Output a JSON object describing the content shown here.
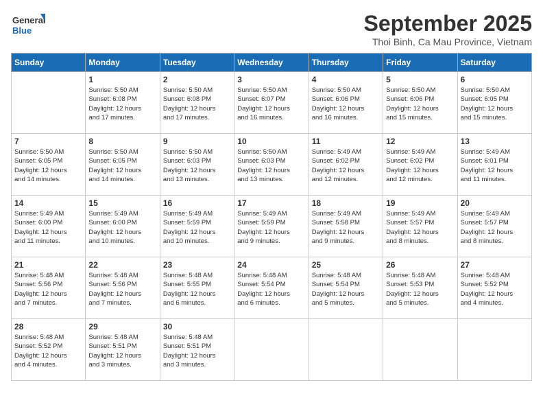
{
  "logo": {
    "line1": "General",
    "line2": "Blue"
  },
  "title": "September 2025",
  "location": "Thoi Binh, Ca Mau Province, Vietnam",
  "days_of_week": [
    "Sunday",
    "Monday",
    "Tuesday",
    "Wednesday",
    "Thursday",
    "Friday",
    "Saturday"
  ],
  "weeks": [
    [
      {
        "day": "",
        "info": ""
      },
      {
        "day": "1",
        "info": "Sunrise: 5:50 AM\nSunset: 6:08 PM\nDaylight: 12 hours\nand 17 minutes."
      },
      {
        "day": "2",
        "info": "Sunrise: 5:50 AM\nSunset: 6:08 PM\nDaylight: 12 hours\nand 17 minutes."
      },
      {
        "day": "3",
        "info": "Sunrise: 5:50 AM\nSunset: 6:07 PM\nDaylight: 12 hours\nand 16 minutes."
      },
      {
        "day": "4",
        "info": "Sunrise: 5:50 AM\nSunset: 6:06 PM\nDaylight: 12 hours\nand 16 minutes."
      },
      {
        "day": "5",
        "info": "Sunrise: 5:50 AM\nSunset: 6:06 PM\nDaylight: 12 hours\nand 15 minutes."
      },
      {
        "day": "6",
        "info": "Sunrise: 5:50 AM\nSunset: 6:05 PM\nDaylight: 12 hours\nand 15 minutes."
      }
    ],
    [
      {
        "day": "7",
        "info": ""
      },
      {
        "day": "8",
        "info": "Sunrise: 5:50 AM\nSunset: 6:05 PM\nDaylight: 12 hours\nand 14 minutes."
      },
      {
        "day": "9",
        "info": "Sunrise: 5:50 AM\nSunset: 6:03 PM\nDaylight: 12 hours\nand 13 minutes."
      },
      {
        "day": "10",
        "info": "Sunrise: 5:50 AM\nSunset: 6:03 PM\nDaylight: 12 hours\nand 13 minutes."
      },
      {
        "day": "11",
        "info": "Sunrise: 5:49 AM\nSunset: 6:02 PM\nDaylight: 12 hours\nand 12 minutes."
      },
      {
        "day": "12",
        "info": "Sunrise: 5:49 AM\nSunset: 6:02 PM\nDaylight: 12 hours\nand 12 minutes."
      },
      {
        "day": "13",
        "info": "Sunrise: 5:49 AM\nSunset: 6:01 PM\nDaylight: 12 hours\nand 11 minutes."
      }
    ],
    [
      {
        "day": "14",
        "info": ""
      },
      {
        "day": "15",
        "info": "Sunrise: 5:49 AM\nSunset: 6:00 PM\nDaylight: 12 hours\nand 10 minutes."
      },
      {
        "day": "16",
        "info": "Sunrise: 5:49 AM\nSunset: 5:59 PM\nDaylight: 12 hours\nand 10 minutes."
      },
      {
        "day": "17",
        "info": "Sunrise: 5:49 AM\nSunset: 5:59 PM\nDaylight: 12 hours\nand 9 minutes."
      },
      {
        "day": "18",
        "info": "Sunrise: 5:49 AM\nSunset: 5:58 PM\nDaylight: 12 hours\nand 9 minutes."
      },
      {
        "day": "19",
        "info": "Sunrise: 5:49 AM\nSunset: 5:57 PM\nDaylight: 12 hours\nand 8 minutes."
      },
      {
        "day": "20",
        "info": "Sunrise: 5:49 AM\nSunset: 5:57 PM\nDaylight: 12 hours\nand 8 minutes."
      }
    ],
    [
      {
        "day": "21",
        "info": ""
      },
      {
        "day": "22",
        "info": "Sunrise: 5:48 AM\nSunset: 5:56 PM\nDaylight: 12 hours\nand 7 minutes."
      },
      {
        "day": "23",
        "info": "Sunrise: 5:48 AM\nSunset: 5:55 PM\nDaylight: 12 hours\nand 6 minutes."
      },
      {
        "day": "24",
        "info": "Sunrise: 5:48 AM\nSunset: 5:54 PM\nDaylight: 12 hours\nand 6 minutes."
      },
      {
        "day": "25",
        "info": "Sunrise: 5:48 AM\nSunset: 5:54 PM\nDaylight: 12 hours\nand 5 minutes."
      },
      {
        "day": "26",
        "info": "Sunrise: 5:48 AM\nSunset: 5:53 PM\nDaylight: 12 hours\nand 5 minutes."
      },
      {
        "day": "27",
        "info": "Sunrise: 5:48 AM\nSunset: 5:52 PM\nDaylight: 12 hours\nand 4 minutes."
      }
    ],
    [
      {
        "day": "28",
        "info": "Sunrise: 5:48 AM\nSunset: 5:52 PM\nDaylight: 12 hours\nand 4 minutes."
      },
      {
        "day": "29",
        "info": "Sunrise: 5:48 AM\nSunset: 5:51 PM\nDaylight: 12 hours\nand 3 minutes."
      },
      {
        "day": "30",
        "info": "Sunrise: 5:48 AM\nSunset: 5:51 PM\nDaylight: 12 hours\nand 3 minutes."
      },
      {
        "day": "",
        "info": ""
      },
      {
        "day": "",
        "info": ""
      },
      {
        "day": "",
        "info": ""
      },
      {
        "day": "",
        "info": ""
      }
    ]
  ],
  "week1_day7_info": "Sunrise: 5:50 AM\nSunset: 6:05 PM\nDaylight: 12 hours\nand 14 minutes.",
  "week1_day1_info": "Sunrise: 5:50 AM\nSunset: 6:05 PM\nDaylight: 12 hours\nand 14 minutes.",
  "week3_day1_info": "Sunrise: 5:49 AM\nSunset: 6:00 PM\nDaylight: 12 hours\nand 11 minutes.",
  "week4_day1_info": "Sunrise: 5:48 AM\nSunset: 5:56 PM\nDaylight: 12 hours\nand 7 minutes."
}
